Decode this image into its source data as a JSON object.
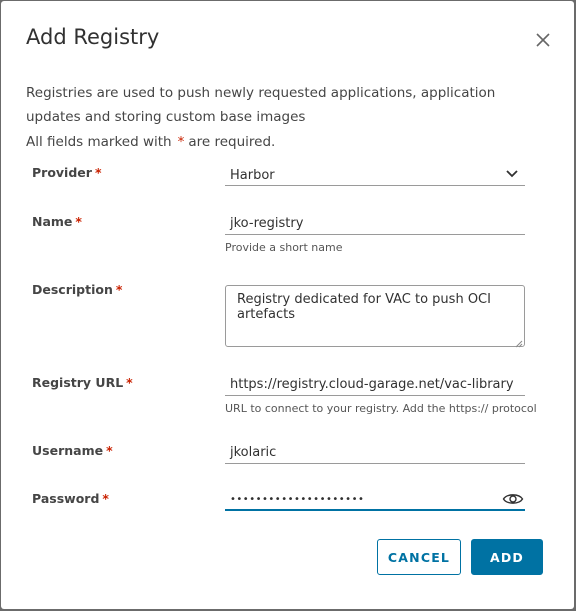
{
  "dialog": {
    "title": "Add Registry",
    "description": "Registries are used to push newly requested applications, application updates and storing custom base images",
    "required_note_prefix": "All fields marked with",
    "required_star": "*",
    "required_note_suffix": "are required."
  },
  "form": {
    "provider": {
      "label": "Provider",
      "value": "Harbor"
    },
    "name": {
      "label": "Name",
      "value": "jko-registry",
      "helper": "Provide a short name"
    },
    "description": {
      "label": "Description",
      "value": "Registry dedicated for VAC to push OCI artefacts"
    },
    "registry_url": {
      "label": "Registry URL",
      "value": "https://registry.cloud-garage.net/vac-library",
      "helper": "URL to connect to your registry. Add the https:// protocol"
    },
    "username": {
      "label": "Username",
      "value": "jkolaric"
    },
    "password": {
      "label": "Password",
      "value": "•••••••••••••••••••••"
    }
  },
  "buttons": {
    "cancel": "CANCEL",
    "add": "ADD"
  },
  "icons": {
    "close": "close-icon",
    "dropdown": "chevron-down-icon",
    "show_password": "eye-icon"
  },
  "colors": {
    "primary": "#0072a3",
    "required": "#c92100",
    "text": "#454545"
  }
}
